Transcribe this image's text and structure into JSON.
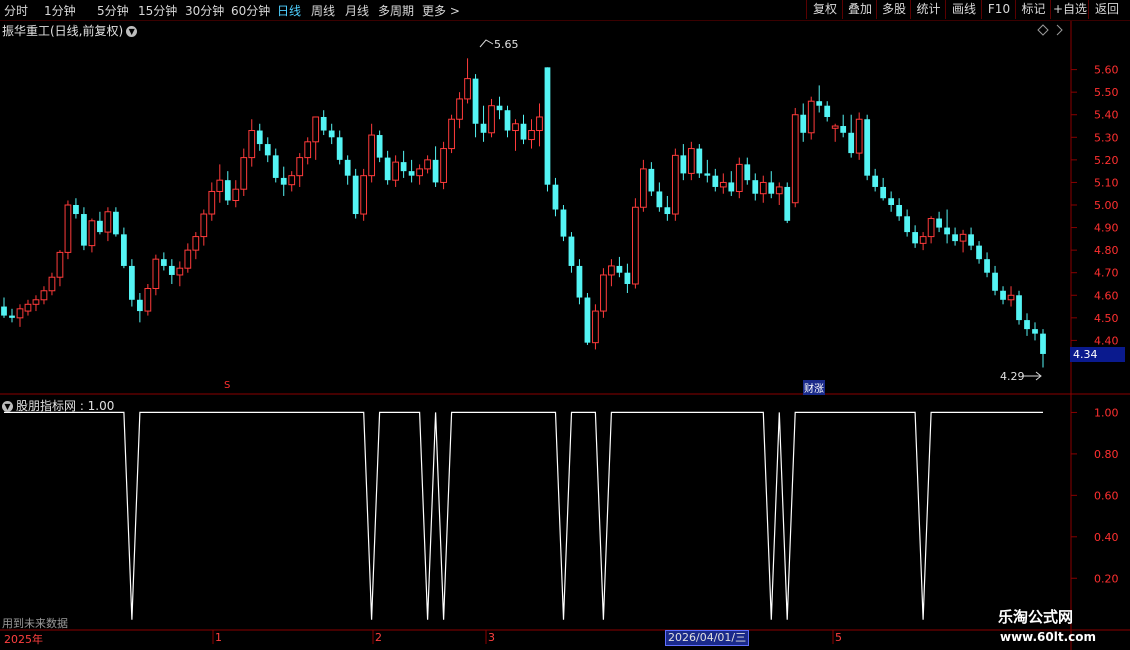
{
  "toolbar": {
    "periods": [
      "分时",
      "1分钟",
      "5分钟",
      "15分钟",
      "30分钟",
      "60分钟",
      "日线",
      "周线",
      "月线",
      "多周期",
      "更多 >"
    ],
    "active_period": "日线",
    "right_buttons": [
      "复权",
      "叠加",
      "多股",
      "统计",
      "画线",
      "F10",
      "标记",
      "+自选",
      "返回"
    ]
  },
  "stock": {
    "title": "振华重工(日线,前复权)",
    "high_label": "5.65",
    "low_label": "4.29",
    "current_price": "4.34",
    "marker_s": "S",
    "marker_news": "财涨"
  },
  "indicator": {
    "title": "股朋指标网 : 1.00",
    "future_note": "用到未来数据"
  },
  "x_axis": {
    "labels": [
      "2025年",
      "1",
      "2",
      "3",
      "5"
    ],
    "cursor_date": "2026/04/01/三"
  },
  "watermark": {
    "line1": "乐淘公式网",
    "line2": "www.60lt.com"
  },
  "colors": {
    "up": "#ff3b3b",
    "down": "#54f4f4",
    "grid": "#8a0000",
    "indicator_line": "#ffffff"
  },
  "chart_data": [
    {
      "type": "candlestick",
      "title": "",
      "y_ticks": [
        "5.60",
        "5.50",
        "5.40",
        "5.30",
        "5.20",
        "5.10",
        "5.00",
        "4.90",
        "4.80",
        "4.70",
        "4.60",
        "4.50",
        "4.40"
      ],
      "ylim": [
        4.26,
        5.74
      ],
      "ohlc": [
        [
          4.55,
          4.59,
          4.5,
          4.51
        ],
        [
          4.51,
          4.54,
          4.48,
          4.5
        ],
        [
          4.5,
          4.56,
          4.46,
          4.54
        ],
        [
          4.53,
          4.58,
          4.51,
          4.56
        ],
        [
          4.56,
          4.6,
          4.53,
          4.58
        ],
        [
          4.58,
          4.64,
          4.56,
          4.62
        ],
        [
          4.62,
          4.7,
          4.6,
          4.68
        ],
        [
          4.68,
          4.8,
          4.64,
          4.79
        ],
        [
          4.79,
          5.02,
          4.76,
          5.0
        ],
        [
          5.0,
          5.03,
          4.94,
          4.96
        ],
        [
          4.96,
          4.99,
          4.8,
          4.82
        ],
        [
          4.82,
          4.94,
          4.79,
          4.93
        ],
        [
          4.93,
          4.97,
          4.87,
          4.88
        ],
        [
          4.88,
          4.99,
          4.84,
          4.97
        ],
        [
          4.97,
          4.99,
          4.86,
          4.87
        ],
        [
          4.87,
          4.9,
          4.72,
          4.73
        ],
        [
          4.73,
          4.76,
          4.55,
          4.58
        ],
        [
          4.58,
          4.61,
          4.48,
          4.53
        ],
        [
          4.53,
          4.65,
          4.51,
          4.63
        ],
        [
          4.63,
          4.78,
          4.6,
          4.76
        ],
        [
          4.76,
          4.79,
          4.71,
          4.73
        ],
        [
          4.73,
          4.76,
          4.65,
          4.69
        ],
        [
          4.69,
          4.75,
          4.64,
          4.72
        ],
        [
          4.72,
          4.83,
          4.7,
          4.8
        ],
        [
          4.8,
          4.88,
          4.76,
          4.86
        ],
        [
          4.86,
          4.98,
          4.82,
          4.96
        ],
        [
          4.96,
          5.1,
          4.93,
          5.06
        ],
        [
          5.06,
          5.18,
          5.01,
          5.11
        ],
        [
          5.11,
          5.15,
          5.0,
          5.02
        ],
        [
          5.02,
          5.11,
          4.99,
          5.07
        ],
        [
          5.07,
          5.25,
          5.04,
          5.21
        ],
        [
          5.21,
          5.38,
          5.17,
          5.33
        ],
        [
          5.33,
          5.36,
          5.24,
          5.27
        ],
        [
          5.27,
          5.3,
          5.19,
          5.22
        ],
        [
          5.22,
          5.25,
          5.1,
          5.12
        ],
        [
          5.12,
          5.17,
          5.04,
          5.09
        ],
        [
          5.09,
          5.15,
          5.06,
          5.13
        ],
        [
          5.13,
          5.23,
          5.08,
          5.21
        ],
        [
          5.21,
          5.3,
          5.18,
          5.28
        ],
        [
          5.28,
          5.35,
          5.2,
          5.39
        ],
        [
          5.39,
          5.42,
          5.31,
          5.33
        ],
        [
          5.33,
          5.36,
          5.27,
          5.3
        ],
        [
          5.3,
          5.33,
          5.18,
          5.2
        ],
        [
          5.2,
          5.22,
          5.09,
          5.13
        ],
        [
          5.13,
          5.16,
          4.94,
          4.96
        ],
        [
          4.96,
          5.16,
          4.93,
          5.13
        ],
        [
          5.13,
          5.36,
          5.1,
          5.31
        ],
        [
          5.31,
          5.33,
          5.19,
          5.21
        ],
        [
          5.21,
          5.24,
          5.09,
          5.11
        ],
        [
          5.11,
          5.22,
          5.08,
          5.19
        ],
        [
          5.19,
          5.24,
          5.12,
          5.15
        ],
        [
          5.15,
          5.2,
          5.1,
          5.13
        ],
        [
          5.13,
          5.18,
          5.09,
          5.16
        ],
        [
          5.16,
          5.22,
          5.14,
          5.2
        ],
        [
          5.2,
          5.26,
          5.08,
          5.1
        ],
        [
          5.1,
          5.28,
          5.07,
          5.25
        ],
        [
          5.25,
          5.4,
          5.23,
          5.38
        ],
        [
          5.38,
          5.5,
          5.34,
          5.47
        ],
        [
          5.47,
          5.65,
          5.45,
          5.56
        ],
        [
          5.56,
          5.58,
          5.3,
          5.36
        ],
        [
          5.36,
          5.44,
          5.28,
          5.32
        ],
        [
          5.32,
          5.47,
          5.3,
          5.44
        ],
        [
          5.44,
          5.48,
          5.38,
          5.42
        ],
        [
          5.42,
          5.44,
          5.3,
          5.33
        ],
        [
          5.33,
          5.38,
          5.24,
          5.36
        ],
        [
          5.36,
          5.4,
          5.27,
          5.29
        ],
        [
          5.29,
          5.38,
          5.25,
          5.33
        ],
        [
          5.33,
          5.45,
          5.26,
          5.39
        ],
        [
          5.61,
          5.61,
          5.06,
          5.09
        ],
        [
          5.09,
          5.12,
          4.95,
          4.98
        ],
        [
          4.98,
          5.0,
          4.84,
          4.86
        ],
        [
          4.86,
          4.88,
          4.7,
          4.73
        ],
        [
          4.73,
          4.76,
          4.56,
          4.59
        ],
        [
          4.59,
          4.61,
          4.38,
          4.39
        ],
        [
          4.39,
          4.56,
          4.36,
          4.53
        ],
        [
          4.53,
          4.72,
          4.5,
          4.69
        ],
        [
          4.69,
          4.76,
          4.64,
          4.73
        ],
        [
          4.73,
          4.77,
          4.68,
          4.7
        ],
        [
          4.7,
          4.74,
          4.61,
          4.65
        ],
        [
          4.65,
          5.03,
          4.63,
          4.99
        ],
        [
          4.99,
          5.2,
          4.97,
          5.16
        ],
        [
          5.16,
          5.19,
          5.04,
          5.06
        ],
        [
          5.06,
          5.1,
          4.97,
          4.99
        ],
        [
          4.99,
          5.04,
          4.93,
          4.96
        ],
        [
          4.96,
          5.25,
          4.93,
          5.22
        ],
        [
          5.22,
          5.27,
          5.11,
          5.14
        ],
        [
          5.14,
          5.28,
          5.11,
          5.25
        ],
        [
          5.25,
          5.27,
          5.12,
          5.14
        ],
        [
          5.14,
          5.2,
          5.1,
          5.13
        ],
        [
          5.13,
          5.16,
          5.06,
          5.08
        ],
        [
          5.08,
          5.14,
          5.05,
          5.1
        ],
        [
          5.1,
          5.15,
          5.04,
          5.06
        ],
        [
          5.06,
          5.21,
          5.03,
          5.18
        ],
        [
          5.18,
          5.21,
          5.09,
          5.11
        ],
        [
          5.11,
          5.14,
          5.02,
          5.05
        ],
        [
          5.05,
          5.13,
          5.01,
          5.1
        ],
        [
          5.1,
          5.15,
          5.03,
          5.05
        ],
        [
          5.05,
          5.1,
          5.0,
          5.08
        ],
        [
          5.08,
          5.1,
          4.92,
          4.93
        ],
        [
          5.01,
          5.43,
          4.99,
          5.4
        ],
        [
          5.4,
          5.45,
          5.28,
          5.32
        ],
        [
          5.32,
          5.48,
          5.29,
          5.46
        ],
        [
          5.46,
          5.53,
          5.41,
          5.44
        ],
        [
          5.44,
          5.46,
          5.37,
          5.39
        ],
        [
          5.34,
          5.36,
          5.28,
          5.35
        ],
        [
          5.35,
          5.4,
          5.3,
          5.32
        ],
        [
          5.32,
          5.4,
          5.21,
          5.23
        ],
        [
          5.23,
          5.41,
          5.2,
          5.38
        ],
        [
          5.38,
          5.4,
          5.11,
          5.13
        ],
        [
          5.13,
          5.16,
          5.06,
          5.08
        ],
        [
          5.08,
          5.12,
          5.02,
          5.03
        ],
        [
          5.03,
          5.06,
          4.97,
          5.0
        ],
        [
          5.0,
          5.03,
          4.93,
          4.95
        ],
        [
          4.95,
          4.98,
          4.86,
          4.88
        ],
        [
          4.88,
          4.91,
          4.81,
          4.83
        ],
        [
          4.83,
          4.88,
          4.8,
          4.86
        ],
        [
          4.86,
          4.95,
          4.83,
          4.94
        ],
        [
          4.94,
          4.97,
          4.88,
          4.9
        ],
        [
          4.9,
          4.98,
          4.83,
          4.87
        ],
        [
          4.87,
          4.9,
          4.82,
          4.84
        ],
        [
          4.84,
          4.89,
          4.79,
          4.87
        ],
        [
          4.87,
          4.9,
          4.8,
          4.82
        ],
        [
          4.82,
          4.84,
          4.74,
          4.76
        ],
        [
          4.76,
          4.79,
          4.68,
          4.7
        ],
        [
          4.7,
          4.73,
          4.6,
          4.62
        ],
        [
          4.62,
          4.64,
          4.56,
          4.58
        ],
        [
          4.58,
          4.64,
          4.55,
          4.6
        ],
        [
          4.6,
          4.62,
          4.47,
          4.49
        ],
        [
          4.49,
          4.52,
          4.42,
          4.45
        ],
        [
          4.45,
          4.48,
          4.4,
          4.43
        ],
        [
          4.43,
          4.45,
          4.28,
          4.34
        ]
      ]
    },
    {
      "type": "line",
      "title": "",
      "y_ticks": [
        "1.00",
        "0.80",
        "0.60",
        "0.40",
        "0.20"
      ],
      "ylim": [
        -0.04,
        1.06
      ],
      "values": [
        1,
        1,
        1,
        1,
        1,
        1,
        1,
        1,
        1,
        1,
        1,
        1,
        1,
        1,
        1,
        1,
        0,
        1,
        1,
        1,
        1,
        1,
        1,
        1,
        1,
        1,
        1,
        1,
        1,
        1,
        1,
        1,
        1,
        1,
        1,
        1,
        1,
        1,
        1,
        1,
        1,
        1,
        1,
        1,
        1,
        1,
        0,
        1,
        1,
        1,
        1,
        1,
        1,
        0,
        1,
        0,
        1,
        1,
        1,
        1,
        1,
        1,
        1,
        1,
        1,
        1,
        1,
        1,
        1,
        1,
        0,
        1,
        1,
        1,
        1,
        0,
        1,
        1,
        1,
        1,
        1,
        1,
        1,
        1,
        1,
        1,
        1,
        1,
        1,
        1,
        1,
        1,
        1,
        1,
        1,
        1,
        0,
        1,
        0,
        1,
        1,
        1,
        1,
        1,
        1,
        1,
        1,
        1,
        1,
        1,
        1,
        1,
        1,
        1,
        1,
        0,
        1,
        1,
        1,
        1,
        1,
        1,
        1,
        1,
        1,
        1,
        1,
        1,
        1,
        1,
        1
      ]
    }
  ]
}
